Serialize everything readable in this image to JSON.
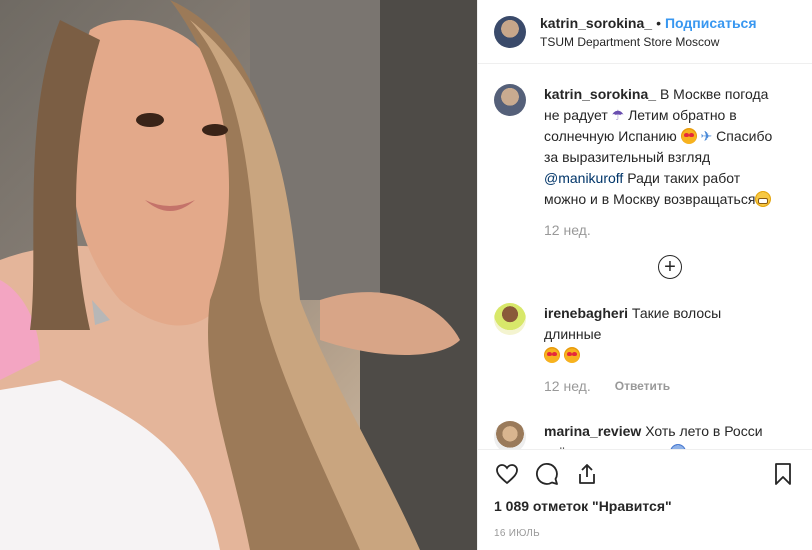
{
  "post": {
    "username": "katrin_sorokina_",
    "separator": "•",
    "follow_label": "Подписаться",
    "location": "TSUM Department Store Moscow"
  },
  "caption": {
    "username": "katrin_sorokina_",
    "text_1": "В Москве погода не радует",
    "text_2": "Летим обратно в солнечную Испанию",
    "text_3": "Спасибо за выразительный взгляд",
    "mention": "@manikuroff",
    "text_4": "Ради таких работ можно и в Москву возвращаться",
    "time": "12 нед."
  },
  "comments": [
    {
      "username": "irenebagheri",
      "text": "Такие волосы длинные",
      "time": "12 нед.",
      "reply_label": "Ответить"
    },
    {
      "username": "marina_review",
      "text": "Хоть лето в Росси всё равно холодно"
    }
  ],
  "likes_text": "1 089 отметок \"Нравится\"",
  "date_text": "16 ИЮЛЬ",
  "icons": [
    "heart-icon",
    "comment-icon",
    "share-icon",
    "bookmark-icon",
    "load-more-plus-icon"
  ]
}
